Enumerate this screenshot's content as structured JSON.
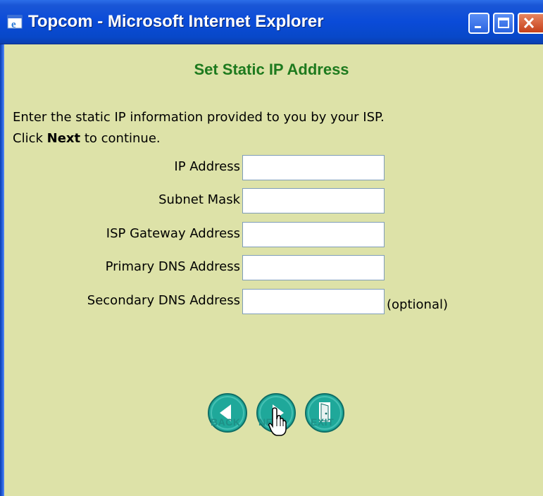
{
  "window": {
    "title": "Topcom - Microsoft Internet Explorer",
    "controls": [
      "minimize",
      "maximize",
      "close"
    ]
  },
  "page": {
    "heading": "Set Static IP Address",
    "instruction_line1": "Enter the static IP information provided to you by your ISP.",
    "instruction_line2_prefix": "Click ",
    "instruction_line2_bold": "Next",
    "instruction_line2_suffix": " to continue."
  },
  "form": {
    "fields": [
      {
        "label": "IP Address",
        "value": ""
      },
      {
        "label": "Subnet Mask",
        "value": ""
      },
      {
        "label": "ISP Gateway Address",
        "value": ""
      },
      {
        "label": "Primary DNS Address",
        "value": ""
      },
      {
        "label": "Secondary DNS Address",
        "value": "",
        "note": "(optional)"
      }
    ]
  },
  "nav": {
    "back_label": "BACK",
    "next_label": "NEXT",
    "exit_label": "EXIT"
  },
  "colors": {
    "background": "#dde2a8",
    "heading": "#1e7a1e",
    "nav_button": "#1fa89a",
    "titlebar": "#0a4bd8"
  },
  "icons": {
    "app": "ie-icon",
    "back": "back-arrow-icon",
    "next": "next-arrow-icon",
    "exit": "exit-door-icon",
    "cursor": "hand-pointer-icon"
  }
}
